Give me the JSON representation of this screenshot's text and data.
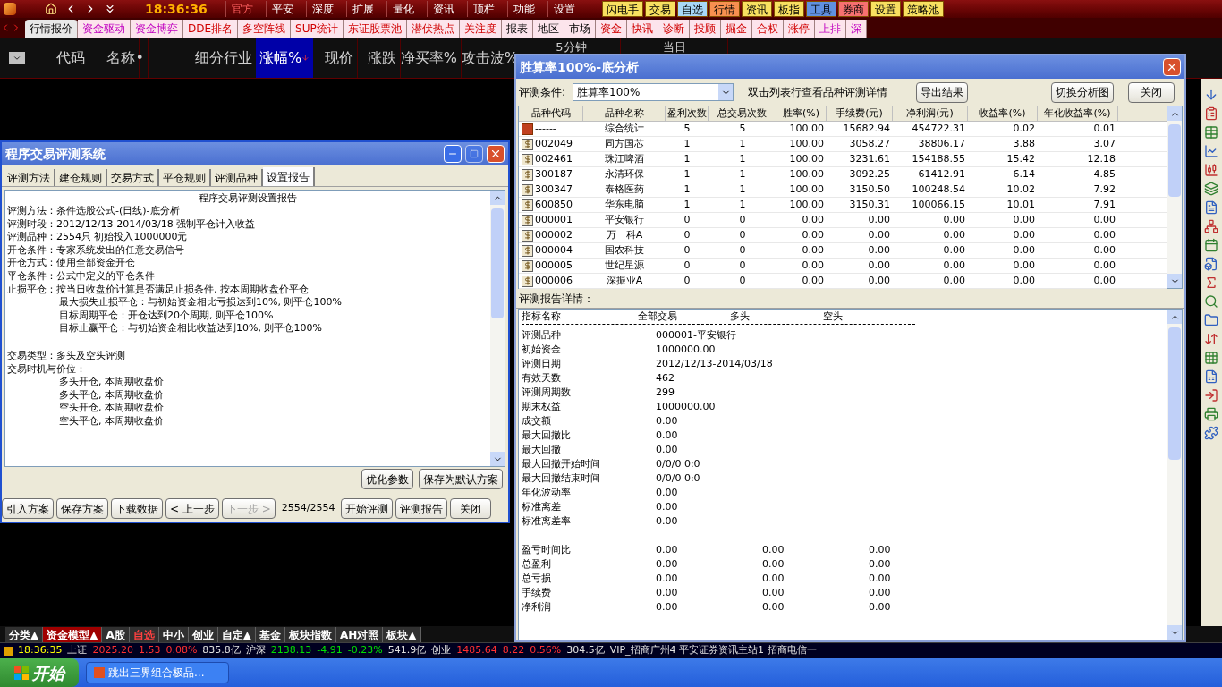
{
  "top_menu": {
    "time": "18:36:36",
    "items": [
      "官方",
      "平安",
      "深度",
      "扩展",
      "量化",
      "资讯",
      "顶栏",
      "功能",
      "设置"
    ],
    "quick_buttons": [
      {
        "label": "闪电手",
        "color": "#f8e060"
      },
      {
        "label": "交易",
        "color": "#f8e060"
      },
      {
        "label": "自选",
        "color": "#a8d8f8"
      },
      {
        "label": "行情",
        "color": "#f89050"
      },
      {
        "label": "资讯",
        "color": "#f8e060"
      },
      {
        "label": "板指",
        "color": "#f8e060"
      },
      {
        "label": "工具",
        "color": "#6090e0"
      },
      {
        "label": "券商",
        "color": "#f87070"
      },
      {
        "label": "设置",
        "color": "#f8e060"
      },
      {
        "label": "策略池",
        "color": "#f8e060"
      }
    ]
  },
  "tabs": [
    {
      "label": "行情报价",
      "selected": true,
      "kind": "plain"
    },
    {
      "label": "资金驱动",
      "selected": false,
      "kind": "pink"
    },
    {
      "label": "资金博弈",
      "selected": false,
      "kind": "pink"
    },
    {
      "label": "DDE排名",
      "selected": false,
      "kind": "red"
    },
    {
      "label": "多空阵线",
      "selected": false,
      "kind": "red"
    },
    {
      "label": "SUP统计",
      "selected": false,
      "kind": "red"
    },
    {
      "label": "东证股票池",
      "selected": false,
      "kind": "red"
    },
    {
      "label": "潜伏热点",
      "selected": false,
      "kind": "red"
    },
    {
      "label": "关注度",
      "selected": false,
      "kind": "red"
    },
    {
      "label": "报表",
      "selected": false,
      "kind": "plain"
    },
    {
      "label": "地区",
      "selected": false,
      "kind": "plain"
    },
    {
      "label": "市场",
      "selected": false,
      "kind": "plain"
    },
    {
      "label": "资金",
      "selected": false,
      "kind": "red"
    },
    {
      "label": "快讯",
      "selected": false,
      "kind": "red"
    },
    {
      "label": "诊断",
      "selected": false,
      "kind": "red"
    },
    {
      "label": "投顾",
      "selected": false,
      "kind": "red"
    },
    {
      "label": "掘金",
      "selected": false,
      "kind": "red"
    },
    {
      "label": "合权",
      "selected": false,
      "kind": "red"
    },
    {
      "label": "涨停",
      "selected": false,
      "kind": "red"
    },
    {
      "label": "上排",
      "selected": false,
      "kind": "pink"
    },
    {
      "label": "深",
      "selected": false,
      "kind": "pink"
    }
  ],
  "quote_header": {
    "columns": [
      {
        "label": "代码",
        "selected": false
      },
      {
        "label": "名称",
        "selected": false
      },
      {
        "label": "•",
        "selected": false
      },
      {
        "label": "细分行业",
        "selected": false
      },
      {
        "label": "涨幅%",
        "selected": true
      },
      {
        "label": "现价",
        "selected": false
      },
      {
        "label": "涨跌",
        "selected": false
      },
      {
        "label": "净买率%",
        "selected": false
      },
      {
        "label": "攻击波%",
        "selected": false
      },
      {
        "label": "5分钟",
        "selected": false
      },
      {
        "label": "当日",
        "selected": false
      }
    ]
  },
  "test_dialog": {
    "title": "程序交易评测系统",
    "tabs": [
      {
        "label": "评测方法",
        "selected": false
      },
      {
        "label": "建仓规则",
        "selected": false
      },
      {
        "label": "交易方式",
        "selected": false
      },
      {
        "label": "平仓规则",
        "selected": false
      },
      {
        "label": "评测品种",
        "selected": false
      },
      {
        "label": "设置报告",
        "selected": true
      }
    ],
    "report_title": "程序交易评测设置报告",
    "report_sections": [
      [
        {
          "text": "评测方法：条件选股公式-(日线)-底分析"
        },
        {
          "text": "评测时段：2012/12/13-2014/03/18 强制平仓计入收益"
        },
        {
          "text": "评测品种：2554只 初始投入1000000元"
        },
        {
          "text": "开仓条件：专家系统发出的任意交易信号"
        },
        {
          "text": "开仓方式：使用全部资金开仓"
        },
        {
          "text": "平仓条件：公式中定义的平仓条件"
        },
        {
          "text": "止损平仓：按当日收盘价计算是否满足止损条件, 按本周期收盘价平仓",
          "children": [
            {
              "text": "最大损失止损平仓：与初始资金相比亏损达到10%, 则平仓100%"
            },
            {
              "text": "目标周期平仓：开仓达到20个周期, 则平仓100%"
            },
            {
              "text": "目标止赢平仓：与初始资金相比收益达到10%, 则平仓100%"
            }
          ]
        }
      ],
      [
        {
          "text": "交易类型：多头及空头评测"
        },
        {
          "text": "交易时机与价位：",
          "children": [
            {
              "text": "多头开仓, 本周期收盘价"
            },
            {
              "text": "多头平仓, 本周期收盘价"
            },
            {
              "text": "空头开仓, 本周期收盘价"
            },
            {
              "text": "空头平仓, 本周期收盘价"
            }
          ]
        }
      ]
    ],
    "inner_buttons": [
      "优化参数",
      "保存为默认方案"
    ],
    "bottom_buttons": [
      {
        "label": "引入方案",
        "disabled": false
      },
      {
        "label": "保存方案",
        "disabled": false
      },
      {
        "label": "下载数据",
        "disabled": false
      },
      {
        "label": "< 上一步",
        "disabled": false
      },
      {
        "label": "下一步 >",
        "disabled": true
      }
    ],
    "progress": "2554/2554",
    "action_buttons": [
      "开始评测",
      "评测报告",
      "关闭"
    ]
  },
  "result_dialog": {
    "title": "胜算率100%-底分析",
    "condition_label": "评测条件:",
    "condition_value": "胜算率100%",
    "hint": "双击列表行查看品种评测详情",
    "buttons": [
      "导出结果",
      "切换分析图",
      "关闭"
    ],
    "columns": [
      "品种代码",
      "品种名称",
      "盈利次数",
      "总交易次数",
      "胜率(%)",
      "手续费(元)",
      "净利润(元)",
      "收益率(%)",
      "年化收益率(%)"
    ],
    "rows": [
      {
        "kind": "summary",
        "cells": [
          "------",
          "综合统计",
          "5",
          "5",
          "100.00",
          "15682.94",
          "454722.31",
          "0.02",
          "0.01"
        ]
      },
      {
        "kind": "stock",
        "cells": [
          "002049",
          "同方国芯",
          "1",
          "1",
          "100.00",
          "3058.27",
          "38806.17",
          "3.88",
          "3.07"
        ]
      },
      {
        "kind": "stock",
        "cells": [
          "002461",
          "珠江啤酒",
          "1",
          "1",
          "100.00",
          "3231.61",
          "154188.55",
          "15.42",
          "12.18"
        ]
      },
      {
        "kind": "stock",
        "cells": [
          "300187",
          "永清环保",
          "1",
          "1",
          "100.00",
          "3092.25",
          "61412.91",
          "6.14",
          "4.85"
        ]
      },
      {
        "kind": "stock",
        "cells": [
          "300347",
          "泰格医药",
          "1",
          "1",
          "100.00",
          "3150.50",
          "100248.54",
          "10.02",
          "7.92"
        ]
      },
      {
        "kind": "stock",
        "cells": [
          "600850",
          "华东电脑",
          "1",
          "1",
          "100.00",
          "3150.31",
          "100066.15",
          "10.01",
          "7.91"
        ]
      },
      {
        "kind": "stock",
        "cells": [
          "000001",
          "平安银行",
          "0",
          "0",
          "0.00",
          "0.00",
          "0.00",
          "0.00",
          "0.00"
        ]
      },
      {
        "kind": "stock",
        "cells": [
          "000002",
          "万　科A",
          "0",
          "0",
          "0.00",
          "0.00",
          "0.00",
          "0.00",
          "0.00"
        ]
      },
      {
        "kind": "stock",
        "cells": [
          "000004",
          "国农科技",
          "0",
          "0",
          "0.00",
          "0.00",
          "0.00",
          "0.00",
          "0.00"
        ]
      },
      {
        "kind": "stock",
        "cells": [
          "000005",
          "世纪星源",
          "0",
          "0",
          "0.00",
          "0.00",
          "0.00",
          "0.00",
          "0.00"
        ]
      },
      {
        "kind": "stock",
        "cells": [
          "000006",
          "深振业A",
          "0",
          "0",
          "0.00",
          "0.00",
          "0.00",
          "0.00",
          "0.00"
        ]
      }
    ],
    "detail_label": "评测报告详情：",
    "detail_columns": [
      "指标名称",
      "全部交易",
      "多头",
      "空头"
    ],
    "detail_sections": [
      [
        {
          "name": "评测品种",
          "values": [
            "000001-平安银行"
          ]
        },
        {
          "name": "初始资金",
          "values": [
            "1000000.00"
          ]
        },
        {
          "name": "评测日期",
          "values": [
            "2012/12/13-2014/03/18"
          ]
        },
        {
          "name": "有效天数",
          "values": [
            "462"
          ]
        },
        {
          "name": "评测周期数",
          "values": [
            "299"
          ]
        },
        {
          "name": "期末权益",
          "values": [
            "1000000.00"
          ]
        },
        {
          "name": "成交额",
          "values": [
            "0.00"
          ]
        },
        {
          "name": "最大回撤比",
          "values": [
            "0.00"
          ]
        },
        {
          "name": "最大回撤",
          "values": [
            "0.00"
          ]
        },
        {
          "name": "最大回撤开始时间",
          "values": [
            "0/0/0 0:0"
          ]
        },
        {
          "name": "最大回撤结束时间",
          "values": [
            "0/0/0 0:0"
          ]
        },
        {
          "name": "年化波动率",
          "values": [
            "0.00"
          ]
        },
        {
          "name": "标准离差",
          "values": [
            "0.00"
          ]
        },
        {
          "name": "标准离差率",
          "values": [
            "0.00"
          ]
        }
      ],
      [
        {
          "name": "盈亏时间比",
          "values": [
            "0.00",
            "0.00",
            "0.00"
          ]
        },
        {
          "name": "总盈利",
          "values": [
            "0.00",
            "0.00",
            "0.00"
          ]
        },
        {
          "name": "总亏损",
          "values": [
            "0.00",
            "0.00",
            "0.00"
          ]
        },
        {
          "name": "手续费",
          "values": [
            "0.00",
            "0.00",
            "0.00"
          ]
        },
        {
          "name": "净利润",
          "values": [
            "0.00",
            "0.00",
            "0.00"
          ]
        }
      ]
    ]
  },
  "bottom_tabs": [
    {
      "label": "分类▲",
      "selected": false,
      "kind": "normal"
    },
    {
      "label": "资金模型▲",
      "selected": true,
      "kind": "normal"
    },
    {
      "label": "A股",
      "selected": false,
      "kind": "normal"
    },
    {
      "label": "自选",
      "selected": false,
      "kind": "highlight"
    },
    {
      "label": "中小",
      "selected": false,
      "kind": "normal"
    },
    {
      "label": "创业",
      "selected": false,
      "kind": "normal"
    },
    {
      "label": "自定▲",
      "selected": false,
      "kind": "normal"
    },
    {
      "label": "基金",
      "selected": false,
      "kind": "normal"
    },
    {
      "label": "板块指数",
      "selected": false,
      "kind": "normal"
    },
    {
      "label": "AH对照",
      "selected": false,
      "kind": "normal"
    },
    {
      "label": "板块▲",
      "selected": false,
      "kind": "normal"
    }
  ],
  "status_bar": [
    {
      "text": "18:36:35",
      "kind": "time"
    },
    {
      "text": "上证",
      "kind": "label"
    },
    {
      "text": "2025.20",
      "kind": "up"
    },
    {
      "text": "1.53",
      "kind": "up"
    },
    {
      "text": "0.08%",
      "kind": "up"
    },
    {
      "text": "835.8亿",
      "kind": "label"
    },
    {
      "text": "沪深",
      "kind": "label"
    },
    {
      "text": "2138.13",
      "kind": "down"
    },
    {
      "text": "-4.91",
      "kind": "down"
    },
    {
      "text": "-0.23%",
      "kind": "down"
    },
    {
      "text": "541.9亿",
      "kind": "label"
    },
    {
      "text": "创业",
      "kind": "label"
    },
    {
      "text": "1485.64",
      "kind": "up"
    },
    {
      "text": "8.22",
      "kind": "up"
    },
    {
      "text": "0.56%",
      "kind": "up"
    },
    {
      "text": "304.5亿",
      "kind": "label"
    },
    {
      "text": "VIP_招商广州4 平安证券资讯主站1 招商电信一",
      "kind": "label"
    }
  ],
  "taskbar": {
    "start": "开始",
    "tasks": [
      "跳出三界组合极品..."
    ]
  }
}
